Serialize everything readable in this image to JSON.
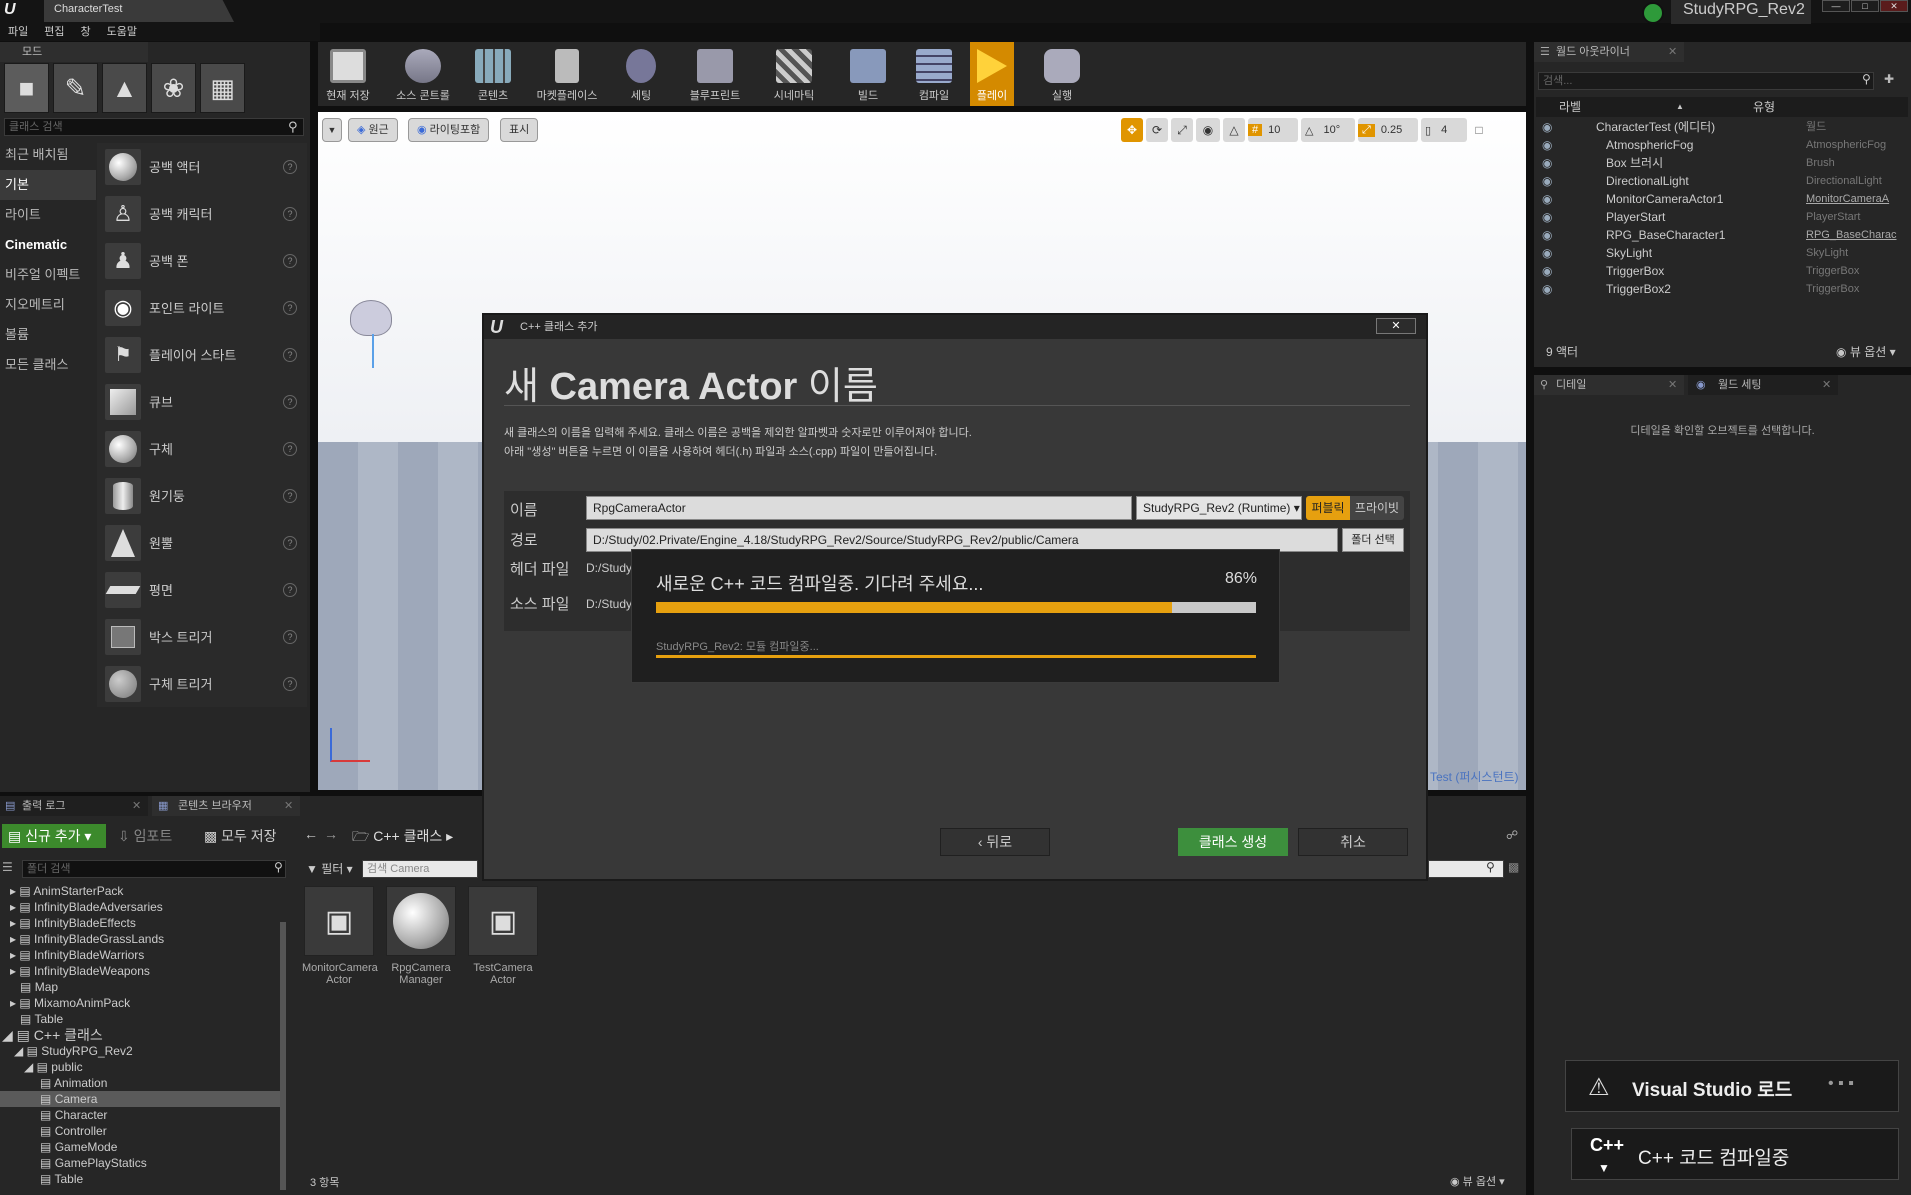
{
  "window": {
    "tab_title": "CharacterTest",
    "project_name": "StudyRPG_Rev2",
    "min": "—",
    "max": "□",
    "close": "✕"
  },
  "menu": [
    "파일",
    "편집",
    "창",
    "도움말"
  ],
  "modes": {
    "title": "모드",
    "search_placeholder": "클래스 검색",
    "categories": [
      "최근 배치됨",
      "기본",
      "라이트",
      "Cinematic",
      "비주얼 이펙트",
      "지오메트리",
      "볼륨",
      "모든 클래스"
    ],
    "items": [
      "공백 액터",
      "공백 캐릭터",
      "공백 폰",
      "포인트 라이트",
      "플레이어 스타트",
      "큐브",
      "구체",
      "원기둥",
      "원뿔",
      "평면",
      "박스 트리거",
      "구체 트리거"
    ]
  },
  "toolbar": [
    "현재 저장",
    "소스 콘트롤",
    "콘텐츠",
    "마켓플레이스",
    "세팅",
    "블루프린트",
    "시네마틱",
    "빌드",
    "컴파일",
    "플레이",
    "실행"
  ],
  "viewport": {
    "perspective": "원근",
    "lit": "라이팅포함",
    "show": "표시",
    "grid_snap": "10",
    "rot_snap": "10°",
    "scale_snap": "0.25",
    "cam_speed": "4",
    "level_label": "Test (퍼시스턴트)"
  },
  "outliner": {
    "title": "월드 아웃라이너",
    "search_placeholder": "검색...",
    "col_label": "라벨",
    "col_type": "유형",
    "rows": [
      {
        "label": "CharacterTest (에디터)",
        "type": "월드"
      },
      {
        "label": "AtmosphericFog",
        "type": "AtmosphericFog"
      },
      {
        "label": "Box 브러시",
        "type": "Brush"
      },
      {
        "label": "DirectionalLight",
        "type": "DirectionalLight"
      },
      {
        "label": "MonitorCameraActor1",
        "type": "MonitorCameraA"
      },
      {
        "label": "PlayerStart",
        "type": "PlayerStart"
      },
      {
        "label": "RPG_BaseCharacter1",
        "type": "RPG_BaseCharac"
      },
      {
        "label": "SkyLight",
        "type": "SkyLight"
      },
      {
        "label": "TriggerBox",
        "type": "TriggerBox"
      },
      {
        "label": "TriggerBox2",
        "type": "TriggerBox"
      }
    ],
    "count": "9 액터",
    "view_options": "뷰 옵션"
  },
  "details": {
    "tab1": "디테일",
    "tab2": "월드 세팅",
    "empty_msg": "디테일을 확인할 오브젝트를 선택합니다."
  },
  "dialog": {
    "title": "C++ 클래스 추가",
    "heading_pre": "새",
    "heading_bold": "Camera Actor",
    "heading_post": "이름",
    "desc1": "새 클래스의 이름을 입력해 주세요. 클래스 이름은 공백을 제외한 알파벳과 숫자로만 이루어져야 합니다.",
    "desc2": "아래 \"생성\" 버튼을 누르면 이 이름을 사용하여 헤더(.h) 파일과 소스(.cpp) 파일이 만들어집니다.",
    "name_label": "이름",
    "name_value": "RpgCameraActor",
    "module": "StudyRPG_Rev2 (Runtime)",
    "public": "퍼블릭",
    "private": "프라이빗",
    "path_label": "경로",
    "path_value": "D:/Study/02.Private/Engine_4.18/StudyRPG_Rev2/Source/StudyRPG_Rev2/public/Camera",
    "choose_folder": "폴더 선택",
    "header_label": "헤더 파일",
    "header_value": "D:/Study",
    "source_label": "소스 파일",
    "source_value": "D:/Study",
    "back": "뒤로",
    "create": "클래스 생성",
    "cancel": "취소"
  },
  "progress": {
    "message": "새로운 C++ 코드 컴파일중. 기다려 주세요...",
    "percent_text": "86%",
    "percent": 0.86,
    "sub": "StudyRPG_Rev2: 모듈 컴파일중..."
  },
  "bottom_tabs": {
    "output": "출력 로그",
    "content": "콘텐츠 브라우저"
  },
  "content_browser": {
    "add_new": "신규 추가",
    "import": "임포트",
    "save_all": "모두 저장",
    "path": "C++ 클래스",
    "folder_search": "폴더 검색",
    "filter": "필터",
    "search_value": "검색 Camera",
    "tree": [
      "AnimStarterPack",
      "InfinityBladeAdversaries",
      "InfinityBladeEffects",
      "InfinityBladeGrassLands",
      "InfinityBladeWarriors",
      "InfinityBladeWeapons",
      "Map",
      "MixamoAnimPack",
      "Table"
    ],
    "cpp_root": "C++ 클래스",
    "cpp_project": "StudyRPG_Rev2",
    "cpp_public": "public",
    "cpp_children": [
      "Animation",
      "Camera",
      "Character",
      "Controller",
      "GameMode",
      "GamePlayStatics",
      "Table"
    ],
    "assets": [
      [
        "MonitorCamera",
        "Actor"
      ],
      [
        "RpgCamera",
        "Manager"
      ],
      [
        "TestCamera",
        "Actor"
      ]
    ],
    "count": "3 항목",
    "view_options": "뷰 옵션"
  },
  "notifications": {
    "vs": "Visual Studio 로드",
    "compile": "C++ 코드 컴파일중"
  },
  "colors": {
    "accent": "#e6a00f",
    "create_button": "#3d8f3d",
    "viewport_sky": "#f0f2f6"
  }
}
